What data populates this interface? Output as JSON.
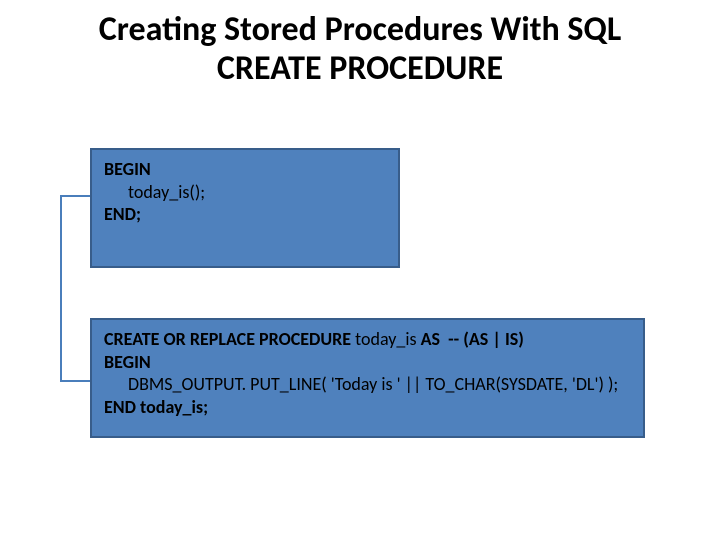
{
  "title_line1": "Creating Stored Procedures With SQL",
  "title_line2": "CREATE PROCEDURE",
  "box1": {
    "l1": "BEGIN",
    "l2": "today_is();",
    "l3": "END;"
  },
  "box2": {
    "l1a": "CREATE OR REPLACE PROCEDURE ",
    "l1b": "today_is ",
    "l1c": "AS  -- (AS | IS)",
    "l2": "BEGIN",
    "l3": "DBMS_OUTPUT. PUT_LINE( 'Today is ' || TO_CHAR(SYSDATE, 'DL') );",
    "l4": "END today_is;"
  }
}
